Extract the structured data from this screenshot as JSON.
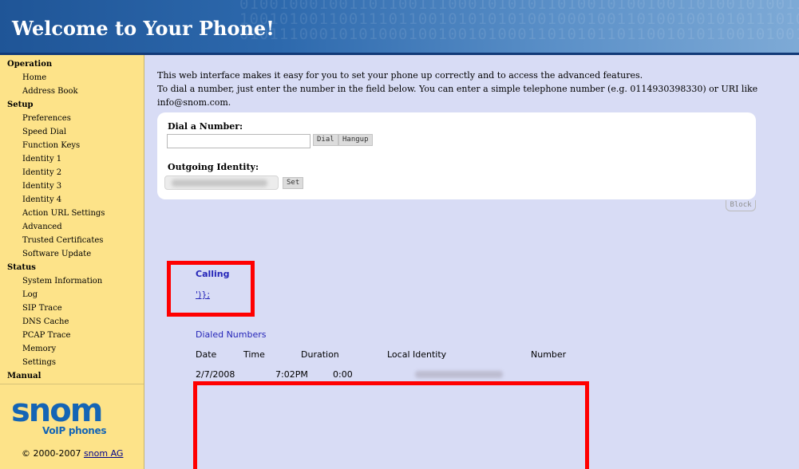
{
  "header": {
    "title": "Welcome to Your Phone!",
    "binary_pattern": "01001000100110110011100010101011010010100100110100101001100100101\n10010100110011101100101010101001000100110100100101011101001101\n01011100010101000100100101000110101011011001010110010100101100\n"
  },
  "sidebar": {
    "items": [
      {
        "label": "Operation",
        "kind": "section"
      },
      {
        "label": "Home",
        "kind": "item"
      },
      {
        "label": "Address Book",
        "kind": "item"
      },
      {
        "label": "Setup",
        "kind": "section"
      },
      {
        "label": "Preferences",
        "kind": "item"
      },
      {
        "label": "Speed Dial",
        "kind": "item"
      },
      {
        "label": "Function Keys",
        "kind": "item"
      },
      {
        "label": "Identity 1",
        "kind": "item"
      },
      {
        "label": "Identity 2",
        "kind": "item"
      },
      {
        "label": "Identity 3",
        "kind": "item"
      },
      {
        "label": "Identity 4",
        "kind": "item"
      },
      {
        "label": "Action URL Settings",
        "kind": "item"
      },
      {
        "label": "Advanced",
        "kind": "item"
      },
      {
        "label": "Trusted Certificates",
        "kind": "item"
      },
      {
        "label": "Software Update",
        "kind": "item"
      },
      {
        "label": "Status",
        "kind": "section"
      },
      {
        "label": "System Information",
        "kind": "item"
      },
      {
        "label": "Log",
        "kind": "item"
      },
      {
        "label": "SIP Trace",
        "kind": "item"
      },
      {
        "label": "DNS Cache",
        "kind": "item"
      },
      {
        "label": "PCAP Trace",
        "kind": "item"
      },
      {
        "label": "Memory",
        "kind": "item"
      },
      {
        "label": "Settings",
        "kind": "item"
      },
      {
        "label": "Manual",
        "kind": "section"
      }
    ],
    "logo": {
      "word": "snom",
      "sub": "VoIP phones"
    },
    "copyright": {
      "text": "© 2000-2007 ",
      "link": "snom AG"
    }
  },
  "main": {
    "intro": {
      "line1": "This web interface makes it easy for you to set your phone up correctly and to access the advanced features.",
      "line2": "To dial a number, just enter the number in the field below. You can enter a simple telephone number (e.g. 0114930398330) or URI like info@snom.com."
    },
    "dial": {
      "label": "Dial a Number:",
      "input_value": "",
      "dial_button": "Dial",
      "hangup_button": "Hangup"
    },
    "outgoing": {
      "label": "Outgoing Identity:",
      "set_button": "Set"
    },
    "block_button": "Block",
    "calling": {
      "title": "Calling",
      "link": "')};"
    },
    "dialed": {
      "title": "Dialed Numbers",
      "columns": [
        "Date",
        "Time",
        "Duration",
        "Local Identity",
        "Number"
      ],
      "rows": [
        {
          "date": "2/7/2008",
          "time": "7:02PM",
          "duration": "0:00",
          "number": ""
        }
      ]
    }
  },
  "colors": {
    "header_dark": "#1f5597",
    "sidebar_bg": "#fde389",
    "page_bg": "#d8dcf5",
    "link_blue": "#2525b8",
    "highlight_red": "#ff0000",
    "logo_blue": "#1565b5"
  }
}
